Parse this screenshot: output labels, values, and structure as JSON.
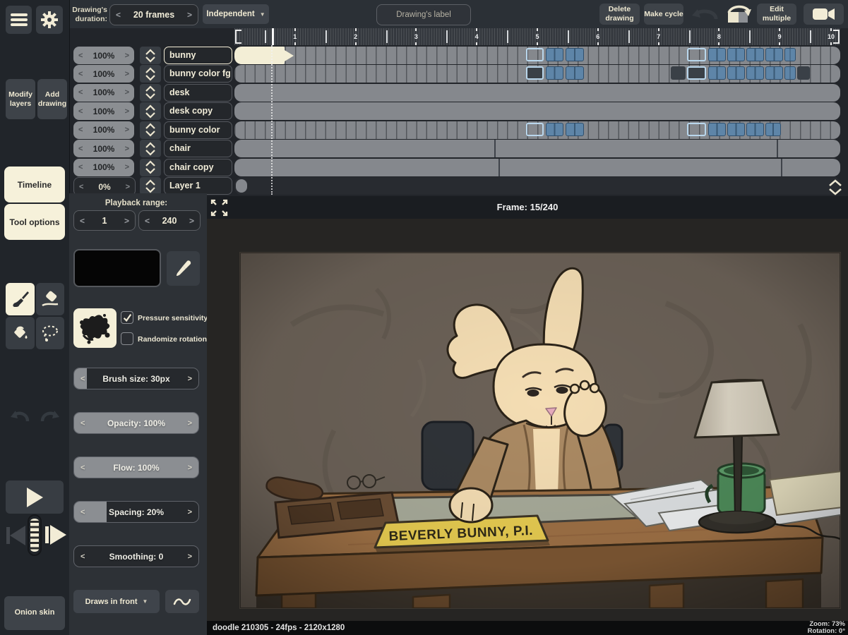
{
  "top_bar": {
    "duration_label_line1": "Drawing's",
    "duration_label_line2": "duration:",
    "duration_value": "20 frames",
    "mode_dropdown": "Independent",
    "drawings_label": "Drawing's label",
    "delete_drawing": "Delete drawing",
    "make_cycle": "Make cycle",
    "edit_multiple": "Edit multiple"
  },
  "left_sidebar": {
    "modify_layers": "Modify layers",
    "add_drawing": "Add drawing",
    "timeline_tab": "Timeline",
    "tool_options_tab": "Tool options",
    "onion_skin": "Onion skin"
  },
  "timeline": {
    "frame_indicator": "Frame: 15/240",
    "playhead_frame": 15,
    "total_frames": 240,
    "ruler_seconds": [
      "1",
      "2",
      "3",
      "4",
      "5",
      "6",
      "7",
      "8",
      "9",
      "10"
    ],
    "layers": [
      {
        "name": "bunny",
        "opacity": "100%",
        "selected": true
      },
      {
        "name": "bunny color fg",
        "opacity": "100%"
      },
      {
        "name": "desk",
        "opacity": "100%"
      },
      {
        "name": "desk copy",
        "opacity": "100%"
      },
      {
        "name": "bunny color",
        "opacity": "100%"
      },
      {
        "name": "chair",
        "opacity": "100%"
      },
      {
        "name": "chair copy",
        "opacity": "100%"
      },
      {
        "name": "Layer 1",
        "opacity": "0%",
        "dim": true
      }
    ],
    "tracks": [
      {
        "style": "frames",
        "cream": true,
        "clusters": [
          [
            413,
            25,
            "o"
          ],
          [
            441,
            25,
            "b"
          ],
          [
            469,
            26,
            "b"
          ],
          [
            641,
            27,
            "o"
          ],
          [
            671,
            25,
            "b"
          ],
          [
            698,
            25,
            "b"
          ],
          [
            725,
            25,
            "b"
          ],
          [
            752,
            25,
            "b"
          ],
          [
            779,
            16,
            "b"
          ]
        ]
      },
      {
        "style": "frames",
        "clusters": [
          [
            413,
            25,
            "od"
          ],
          [
            441,
            25,
            "b"
          ],
          [
            469,
            26,
            "b"
          ],
          [
            618,
            21,
            "d"
          ],
          [
            641,
            27,
            "od"
          ],
          [
            671,
            25,
            "b"
          ],
          [
            698,
            25,
            "b"
          ],
          [
            725,
            25,
            "b"
          ],
          [
            752,
            25,
            "b"
          ],
          [
            779,
            16,
            "b"
          ],
          [
            797,
            18,
            "d"
          ]
        ]
      },
      {
        "style": "solid"
      },
      {
        "style": "solid"
      },
      {
        "style": "frames",
        "clusters": [
          [
            413,
            25,
            "o"
          ],
          [
            441,
            25,
            "b"
          ],
          [
            469,
            26,
            "b"
          ],
          [
            641,
            27,
            "o"
          ],
          [
            671,
            25,
            "b"
          ],
          [
            698,
            25,
            "b"
          ],
          [
            725,
            25,
            "b"
          ],
          [
            752,
            22,
            "b"
          ]
        ]
      },
      {
        "style": "solid",
        "dividers": [
          368,
          768
        ]
      },
      {
        "style": "solid",
        "dividers": [
          374,
          774
        ]
      },
      {
        "style": "empty",
        "block": true
      }
    ]
  },
  "playback_range": {
    "label": "Playback range:",
    "start": "1",
    "end": "240"
  },
  "tool_options": {
    "pressure_sensitivity": {
      "label": "Pressure sensitivity",
      "checked": true
    },
    "randomize_rotation": {
      "label": "Randomize rotation",
      "checked": false
    },
    "sliders": [
      {
        "text": "Brush size:  30px",
        "fill": 10
      },
      {
        "text": "Opacity:  100%",
        "fill": 100
      },
      {
        "text": "Flow:  100%",
        "fill": 100
      },
      {
        "text": "Spacing:  20%",
        "fill": 26
      },
      {
        "text": "Smoothing:  0",
        "fill": 0
      }
    ],
    "draws_in_front": "Draws in front"
  },
  "status_bar": {
    "project_info": "doodle 210305 - 24fps - 2120x1280",
    "zoom": "Zoom: 73%",
    "rotation": "Rotation: 0°"
  },
  "canvas": {
    "nameplate_text": "BEVERLY BUNNY, P.I."
  },
  "colors": {
    "accent_cream": "#f6f1da",
    "selection_blue": "#5e85a8",
    "selection_outline": "#b9d6ec",
    "track_gray": "#85888d"
  }
}
